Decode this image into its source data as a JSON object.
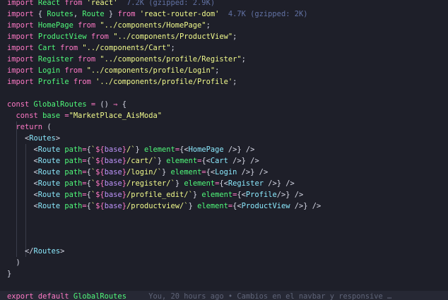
{
  "lines": [
    {
      "parts": [
        [
          "k",
          "import"
        ],
        [
          "p",
          " "
        ],
        [
          "c",
          "React"
        ],
        [
          "p",
          " "
        ],
        [
          "k",
          "from"
        ],
        [
          "p",
          " "
        ],
        [
          "s",
          "'react'"
        ],
        [
          "dim",
          "  7.2K (gzipped: 2.9K)"
        ]
      ]
    },
    {
      "parts": [
        [
          "k",
          "import"
        ],
        [
          "p",
          " { "
        ],
        [
          "c",
          "Routes"
        ],
        [
          "p",
          ", "
        ],
        [
          "c",
          "Route"
        ],
        [
          "p",
          " } "
        ],
        [
          "k",
          "from"
        ],
        [
          "p",
          " "
        ],
        [
          "s",
          "'react-router-dom'"
        ],
        [
          "dim",
          "  4.7K (gzipped: 2K)"
        ]
      ]
    },
    {
      "parts": [
        [
          "k",
          "import"
        ],
        [
          "p",
          " "
        ],
        [
          "c",
          "HomePage"
        ],
        [
          "p",
          " "
        ],
        [
          "k",
          "from"
        ],
        [
          "p",
          " "
        ],
        [
          "s",
          "\"../components/HomePage\""
        ],
        [
          "p",
          ";"
        ]
      ]
    },
    {
      "parts": [
        [
          "k",
          "import"
        ],
        [
          "p",
          " "
        ],
        [
          "c",
          "ProductView"
        ],
        [
          "p",
          " "
        ],
        [
          "k",
          "from"
        ],
        [
          "p",
          " "
        ],
        [
          "s",
          "\"../components/ProductView\""
        ],
        [
          "p",
          ";"
        ]
      ]
    },
    {
      "parts": [
        [
          "k",
          "import"
        ],
        [
          "p",
          " "
        ],
        [
          "c",
          "Cart"
        ],
        [
          "p",
          " "
        ],
        [
          "k",
          "from"
        ],
        [
          "p",
          " "
        ],
        [
          "s",
          "\"../components/Cart\""
        ],
        [
          "p",
          ";"
        ]
      ]
    },
    {
      "parts": [
        [
          "k",
          "import"
        ],
        [
          "p",
          " "
        ],
        [
          "c",
          "Register"
        ],
        [
          "p",
          " "
        ],
        [
          "k",
          "from"
        ],
        [
          "p",
          " "
        ],
        [
          "s",
          "\"../components/profile/Register\""
        ],
        [
          "p",
          ";"
        ]
      ]
    },
    {
      "parts": [
        [
          "k",
          "import"
        ],
        [
          "p",
          " "
        ],
        [
          "c",
          "Login"
        ],
        [
          "p",
          " "
        ],
        [
          "k",
          "from"
        ],
        [
          "p",
          " "
        ],
        [
          "s",
          "\"../components/profile/Login\""
        ],
        [
          "p",
          ";"
        ]
      ]
    },
    {
      "parts": [
        [
          "k",
          "import"
        ],
        [
          "p",
          " "
        ],
        [
          "c",
          "Profile"
        ],
        [
          "p",
          " "
        ],
        [
          "k",
          "from"
        ],
        [
          "p",
          " "
        ],
        [
          "s",
          "'../components/profile/Profile'"
        ],
        [
          "p",
          ";"
        ]
      ]
    },
    {
      "parts": []
    },
    {
      "parts": [
        [
          "k",
          "const"
        ],
        [
          "p",
          " "
        ],
        [
          "c",
          "GlobalRoutes"
        ],
        [
          "p",
          " "
        ],
        [
          "o",
          "="
        ],
        [
          "p",
          " () "
        ],
        [
          "o",
          "⇒"
        ],
        [
          "p",
          " {"
        ]
      ]
    },
    {
      "parts": [
        [
          "p",
          "  "
        ],
        [
          "k",
          "const"
        ],
        [
          "p",
          " "
        ],
        [
          "c",
          "base"
        ],
        [
          "p",
          " "
        ],
        [
          "o",
          "="
        ],
        [
          "s",
          "\"MarketPlace_AisModa\""
        ]
      ]
    },
    {
      "parts": [
        [
          "p",
          "  "
        ],
        [
          "k",
          "return"
        ],
        [
          "p",
          " ("
        ]
      ]
    },
    {
      "parts": [
        [
          "p",
          "    <"
        ],
        [
          "t",
          "Routes"
        ],
        [
          "p",
          ">"
        ]
      ]
    },
    {
      "parts": [
        [
          "p",
          "      <"
        ],
        [
          "t",
          "Route"
        ],
        [
          "p",
          " "
        ],
        [
          "a",
          "path"
        ],
        [
          "o",
          "="
        ],
        [
          "p",
          "{"
        ],
        [
          "s",
          "`"
        ],
        [
          "o",
          "${"
        ],
        [
          "i",
          "base"
        ],
        [
          "o",
          "}"
        ],
        [
          "s",
          "/`"
        ],
        [
          "p",
          "} "
        ],
        [
          "a",
          "element"
        ],
        [
          "o",
          "="
        ],
        [
          "p",
          "{<"
        ],
        [
          "t",
          "HomePage"
        ],
        [
          "p",
          " />} />"
        ]
      ]
    },
    {
      "parts": [
        [
          "p",
          "      <"
        ],
        [
          "t",
          "Route"
        ],
        [
          "p",
          " "
        ],
        [
          "a",
          "path"
        ],
        [
          "o",
          "="
        ],
        [
          "p",
          "{"
        ],
        [
          "s",
          "`"
        ],
        [
          "o",
          "${"
        ],
        [
          "i",
          "base"
        ],
        [
          "o",
          "}"
        ],
        [
          "s",
          "/cart/`"
        ],
        [
          "p",
          "} "
        ],
        [
          "a",
          "element"
        ],
        [
          "o",
          "="
        ],
        [
          "p",
          "{<"
        ],
        [
          "t",
          "Cart"
        ],
        [
          "p",
          " />} />"
        ]
      ]
    },
    {
      "parts": [
        [
          "p",
          "      <"
        ],
        [
          "t",
          "Route"
        ],
        [
          "p",
          " "
        ],
        [
          "a",
          "path"
        ],
        [
          "o",
          "="
        ],
        [
          "p",
          "{"
        ],
        [
          "s",
          "`"
        ],
        [
          "o",
          "${"
        ],
        [
          "i",
          "base"
        ],
        [
          "o",
          "}"
        ],
        [
          "s",
          "/login/`"
        ],
        [
          "p",
          "} "
        ],
        [
          "a",
          "element"
        ],
        [
          "o",
          "="
        ],
        [
          "p",
          "{<"
        ],
        [
          "t",
          "Login"
        ],
        [
          "p",
          " />} />"
        ]
      ]
    },
    {
      "parts": [
        [
          "p",
          "      <"
        ],
        [
          "t",
          "Route"
        ],
        [
          "p",
          " "
        ],
        [
          "a",
          "path"
        ],
        [
          "o",
          "="
        ],
        [
          "p",
          "{"
        ],
        [
          "s",
          "`"
        ],
        [
          "o",
          "${"
        ],
        [
          "i",
          "base"
        ],
        [
          "o",
          "}"
        ],
        [
          "s",
          "/register/`"
        ],
        [
          "p",
          "} "
        ],
        [
          "a",
          "element"
        ],
        [
          "o",
          "="
        ],
        [
          "p",
          "{<"
        ],
        [
          "t",
          "Register"
        ],
        [
          "p",
          " />} />"
        ]
      ]
    },
    {
      "parts": [
        [
          "p",
          "      <"
        ],
        [
          "t",
          "Route"
        ],
        [
          "p",
          " "
        ],
        [
          "a",
          "path"
        ],
        [
          "o",
          "="
        ],
        [
          "p",
          "{"
        ],
        [
          "s",
          "`"
        ],
        [
          "o",
          "${"
        ],
        [
          "i",
          "base"
        ],
        [
          "o",
          "}"
        ],
        [
          "s",
          "/profile_edit/`"
        ],
        [
          "p",
          "} "
        ],
        [
          "a",
          "element"
        ],
        [
          "o",
          "="
        ],
        [
          "p",
          "{<"
        ],
        [
          "t",
          "Profile"
        ],
        [
          "p",
          "/>} />"
        ]
      ]
    },
    {
      "parts": [
        [
          "p",
          "      <"
        ],
        [
          "t",
          "Route"
        ],
        [
          "p",
          " "
        ],
        [
          "a",
          "path"
        ],
        [
          "o",
          "="
        ],
        [
          "p",
          "{"
        ],
        [
          "s",
          "`"
        ],
        [
          "o",
          "${"
        ],
        [
          "i",
          "base"
        ],
        [
          "o",
          "}"
        ],
        [
          "s",
          "/productview/`"
        ],
        [
          "p",
          "} "
        ],
        [
          "a",
          "element"
        ],
        [
          "o",
          "="
        ],
        [
          "p",
          "{<"
        ],
        [
          "t",
          "ProductView"
        ],
        [
          "p",
          " />} />"
        ]
      ]
    },
    {
      "parts": []
    },
    {
      "parts": []
    },
    {
      "parts": []
    },
    {
      "parts": [
        [
          "p",
          "    </"
        ],
        [
          "t",
          "Routes"
        ],
        [
          "p",
          ">"
        ]
      ]
    },
    {
      "parts": [
        [
          "p",
          "  )"
        ]
      ]
    },
    {
      "parts": [
        [
          "p",
          "}"
        ]
      ]
    },
    {
      "parts": []
    },
    {
      "parts": [
        [
          "k",
          "export"
        ],
        [
          "p",
          " "
        ],
        [
          "k",
          "default"
        ],
        [
          "p",
          " "
        ],
        [
          "c",
          "GlobalRoutes"
        ]
      ]
    }
  ],
  "blame": "You, 20 hours ago • Cambios en el navbar y responsive …"
}
